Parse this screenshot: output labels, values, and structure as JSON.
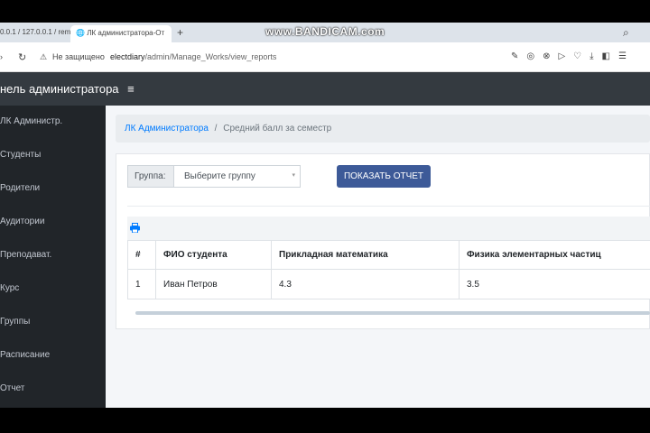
{
  "browser": {
    "tab_prev": "0.0.1 / 127.0.0.1 / rem",
    "tab_active": "ЛК администратора-От",
    "watermark": "www.BANDICAM.com",
    "security": "Не защищено",
    "url_host": "electdiary",
    "url_path": "/admin/Manage_Works/view_reports"
  },
  "header": {
    "title": "нель администратора",
    "menu_icon": "≡"
  },
  "sidebar": {
    "items": [
      {
        "label": "ЛК Администр."
      },
      {
        "label": "Студенты"
      },
      {
        "label": "Родители"
      },
      {
        "label": "Аудитории"
      },
      {
        "label": "Преподават."
      },
      {
        "label": "Курс"
      },
      {
        "label": "Группы"
      },
      {
        "label": "Расписание"
      },
      {
        "label": "Отчет"
      }
    ]
  },
  "breadcrumb": {
    "home": "ЛК Администратора",
    "sep": "/",
    "current": "Средний балл за семестр"
  },
  "filter": {
    "group_label": "Группа:",
    "group_placeholder": "Выберите группу",
    "show_button": "ПОКАЗАТЬ ОТЧЕТ"
  },
  "table": {
    "headers": [
      "#",
      "ФИО студента",
      "Прикладная математика",
      "Физика элементарных частиц"
    ],
    "rows": [
      [
        "1",
        "Иван Петров",
        "4.3",
        "3.5"
      ]
    ]
  },
  "colors": {
    "accent": "#007bff",
    "button": "#3d5a98",
    "sidebar": "#212529",
    "navbar": "#343a40"
  }
}
